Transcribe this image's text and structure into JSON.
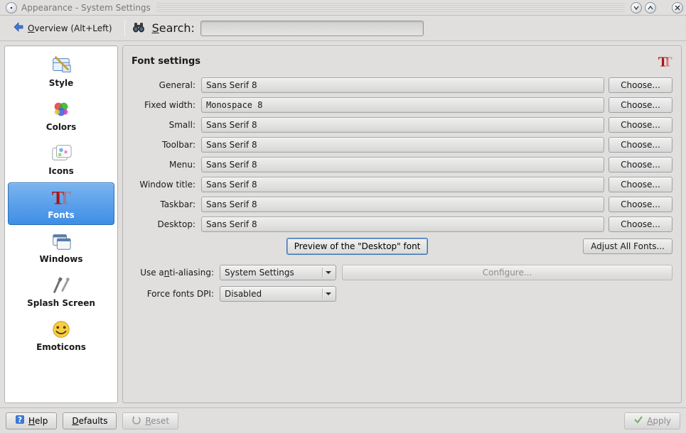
{
  "window": {
    "title": "Appearance - System Settings"
  },
  "toolbar": {
    "overview_label_html": "<span class='ul'>O</span>verview (Alt+Left)",
    "search_label_html": "<span class='ul'>S</span>earch:",
    "search_value": ""
  },
  "sidebar": {
    "items": [
      {
        "id": "style",
        "label": "Style"
      },
      {
        "id": "colors",
        "label": "Colors"
      },
      {
        "id": "icons",
        "label": "Icons"
      },
      {
        "id": "fonts",
        "label": "Fonts",
        "selected": true
      },
      {
        "id": "windows",
        "label": "Windows"
      },
      {
        "id": "splash",
        "label": "Splash Screen"
      },
      {
        "id": "emoticons",
        "label": "Emoticons"
      }
    ]
  },
  "panel": {
    "title": "Font settings",
    "rows": [
      {
        "label": "General:",
        "value": "Sans Serif 8"
      },
      {
        "label": "Fixed width:",
        "value": "Monospace  8",
        "mono": true
      },
      {
        "label": "Small:",
        "value": "Sans Serif 8"
      },
      {
        "label": "Toolbar:",
        "value": "Sans Serif 8"
      },
      {
        "label": "Menu:",
        "value": "Sans Serif 8"
      },
      {
        "label": "Window title:",
        "value": "Sans Serif 8"
      },
      {
        "label": "Taskbar:",
        "value": "Sans Serif 8"
      },
      {
        "label": "Desktop:",
        "value": "Sans Serif 8"
      }
    ],
    "choose_label": "Choose...",
    "preview_label": "Preview of the \"Desktop\" font",
    "adjust_all_label": "Adjust All Fonts...",
    "aa_label_html": "Use a<span class='ul'>n</span>ti-aliasing:",
    "aa_value": "System Settings",
    "configure_label": "Configure...",
    "dpi_label": "Force fonts DPI:",
    "dpi_value": "Disabled"
  },
  "footer": {
    "help_label_html": "<span class='ul'>H</span>elp",
    "defaults_label_html": "<span class='ul'>D</span>efaults",
    "reset_label_html": "<span class='ul'>R</span>eset",
    "apply_label_html": "<span class='ul'>A</span>pply"
  }
}
